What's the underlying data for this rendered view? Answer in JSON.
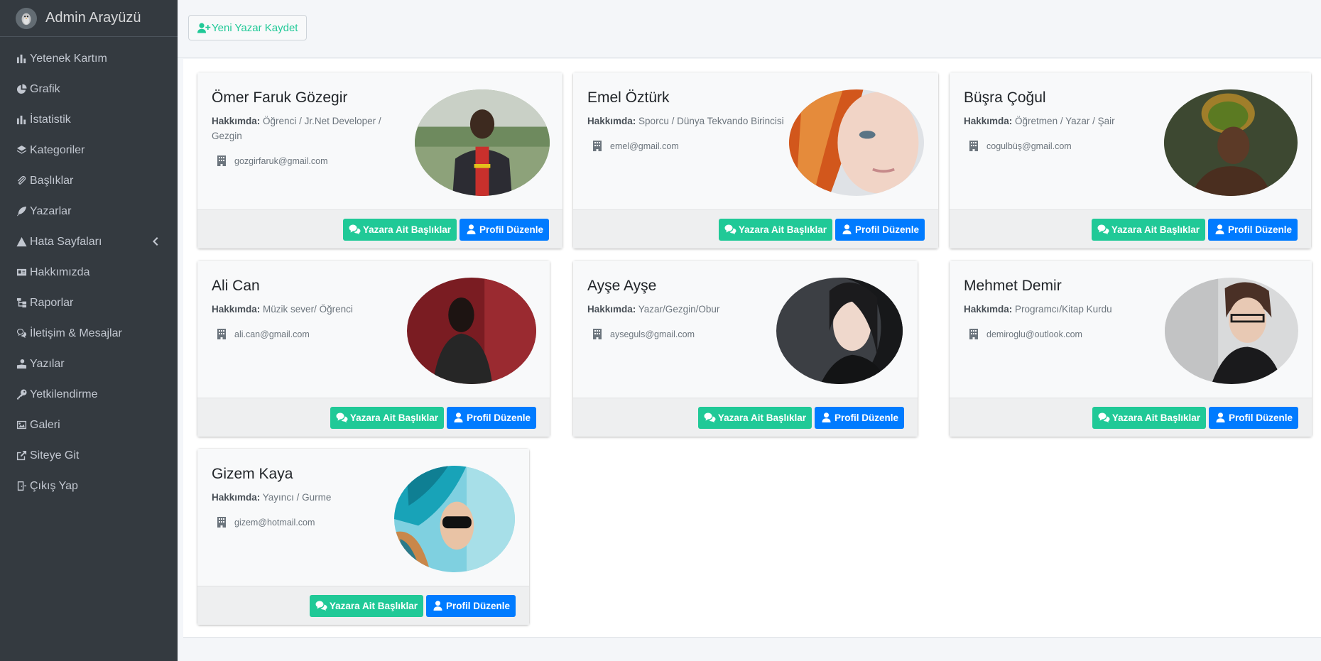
{
  "brand": {
    "title": "Admin Arayüzü",
    "logo_icon": "penguin-logo"
  },
  "sidebar": {
    "items": [
      {
        "label": "Yetenek Kartım",
        "icon": "bar-chart-icon"
      },
      {
        "label": "Grafik",
        "icon": "pie-chart-icon"
      },
      {
        "label": "İstatistik",
        "icon": "bar-chart-icon"
      },
      {
        "label": "Kategoriler",
        "icon": "layers-icon"
      },
      {
        "label": "Başlıklar",
        "icon": "paperclip-icon"
      },
      {
        "label": "Yazarlar",
        "icon": "feather-icon"
      },
      {
        "label": "Hata Sayfaları",
        "icon": "warning-icon"
      },
      {
        "label": "Hakkımızda",
        "icon": "id-card-icon"
      },
      {
        "label": "Raporlar",
        "icon": "sitemap-icon"
      },
      {
        "label": "İletişim & Mesajlar",
        "icon": "comments-icon"
      },
      {
        "label": "Yazılar",
        "icon": "user-book-icon"
      },
      {
        "label": "Yetkilendirme",
        "icon": "key-icon"
      },
      {
        "label": "Galeri",
        "icon": "image-icon"
      },
      {
        "label": "Siteye Git",
        "icon": "external-link-icon"
      },
      {
        "label": "Çıkış Yap",
        "icon": "door-exit-icon"
      }
    ]
  },
  "toolbar": {
    "new_writer_label": "Yeni Yazar Kaydet"
  },
  "labels": {
    "about_prefix": "Hakkımda:",
    "writer_titles": "Yazara Ait Başlıklar",
    "edit_profile": "Profil Düzenle"
  },
  "colors": {
    "accent_green": "#20c997",
    "accent_blue": "#007bff",
    "sidebar_bg": "#343a40"
  },
  "writers": [
    {
      "name": "Ömer Faruk Gözegir",
      "about": "Öğrenci / Jr.Net Developer / Gezgin",
      "email": "gozgirfaruk@gmail.com"
    },
    {
      "name": "Emel Öztürk",
      "about": "Sporcu / Dünya Tekvando Birincisi",
      "email": "emel@gmail.com"
    },
    {
      "name": "Büşra Çoğul",
      "about": "Öğretmen / Yazar / Şair",
      "email": "cogulbüş@gmail.com"
    },
    {
      "name": "Ali Can",
      "about": "Müzik sever/ Öğrenci",
      "email": "ali.can@gmail.com"
    },
    {
      "name": "Ayşe Ayşe",
      "about": "Yazar/Gezgin/Obur",
      "email": "ayseguls@gmail.com"
    },
    {
      "name": "Mehmet Demir",
      "about": "Programcı/Kitap Kurdu",
      "email": "demiroglu@outlook.com"
    },
    {
      "name": "Gizem Kaya",
      "about": "Yayıncı / Gurme",
      "email": "gizem@hotmail.com"
    }
  ]
}
